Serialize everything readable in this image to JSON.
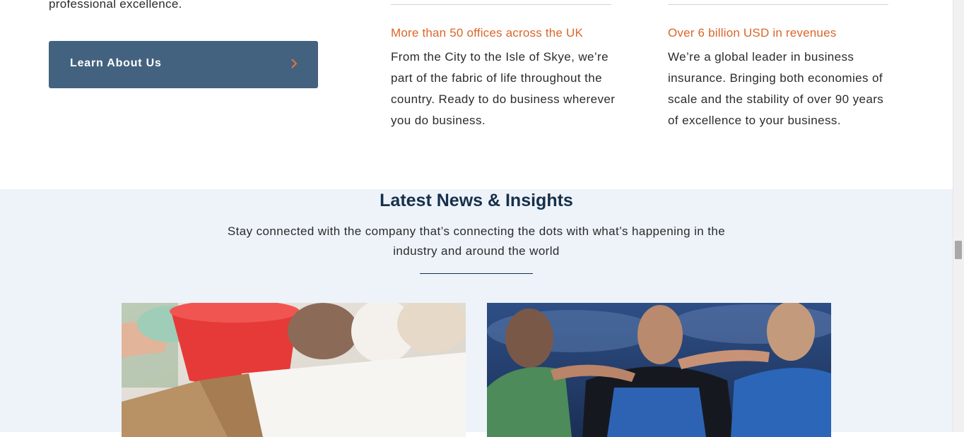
{
  "intro": {
    "tail_text": "professional excellence."
  },
  "cta": {
    "label": "Learn About Us"
  },
  "stats": [
    {
      "heading": "More than 50 offices across the UK",
      "body": "From the City to the Isle of Skye, we’re part of the fabric of life throughout the country. Ready to do business wherever you do business."
    },
    {
      "heading": "Over 6 billion USD in revenues",
      "body": "We’re a global leader in business insurance. Bringing both economies of scale and the stability of over 90 years of excellence to your business."
    }
  ],
  "news": {
    "title": "Latest News & Insights",
    "subtitle": "Stay connected with the company that’s connecting the dots with what’s happening in the industry and around the world"
  },
  "icons": {
    "cta_arrow": "chevron-right-icon"
  },
  "colors": {
    "accent": "#d9662a",
    "button": "#43627f",
    "heading": "#163049",
    "news_bg": "#eef3fa"
  }
}
